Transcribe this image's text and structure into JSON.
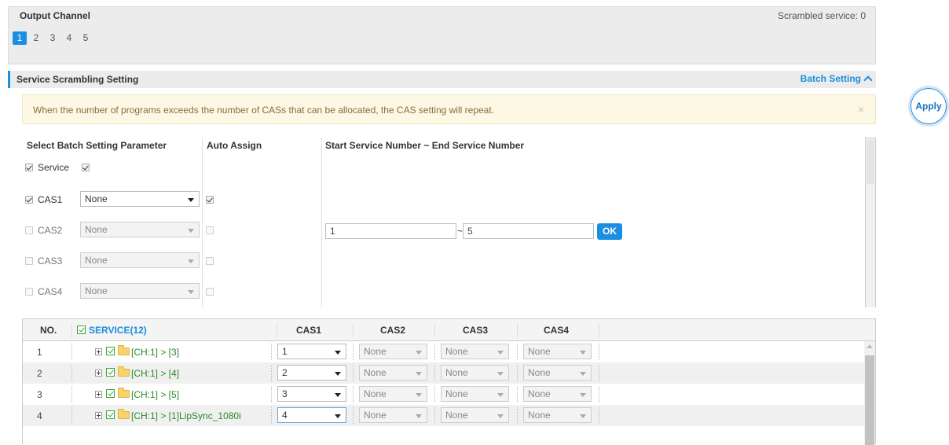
{
  "output_channel": {
    "title": "Output Channel",
    "scrambled_service": "Scrambled service: 0",
    "tabs": [
      "1",
      "2",
      "3",
      "4",
      "5"
    ],
    "active_tab": "1"
  },
  "section": {
    "title": "Service Scrambling Setting",
    "batch_setting": "Batch Setting"
  },
  "apply_label": "Apply",
  "alert": {
    "text": "When the number of programs exceeds the number of CASs that can be allocated, the CAS setting will repeat.",
    "close": "×"
  },
  "batch": {
    "col_param": "Select Batch Setting Parameter",
    "col_auto": "Auto Assign",
    "col_range": "Start Service Number ~ End Service Number",
    "service_label": "Service",
    "cas_rows": [
      {
        "label": "CAS1",
        "value": "None"
      },
      {
        "label": "CAS2",
        "value": "None"
      },
      {
        "label": "CAS3",
        "value": "None"
      },
      {
        "label": "CAS4",
        "value": "None"
      }
    ],
    "start_value": "1",
    "tilde": "~",
    "end_value": "5",
    "ok_label": "OK"
  },
  "table": {
    "headers": {
      "no": "NO.",
      "service": "SERVICE(12)",
      "cas1": "CAS1",
      "cas2": "CAS2",
      "cas3": "CAS3",
      "cas4": "CAS4"
    },
    "rows": [
      {
        "no": "1",
        "service": "[CH:1] > [3]",
        "cas1": "1",
        "cas2": "None",
        "cas3": "None",
        "cas4": "None"
      },
      {
        "no": "2",
        "service": "[CH:1] > [4]",
        "cas1": "2",
        "cas2": "None",
        "cas3": "None",
        "cas4": "None"
      },
      {
        "no": "3",
        "service": "[CH:1] > [5]",
        "cas1": "3",
        "cas2": "None",
        "cas3": "None",
        "cas4": "None"
      },
      {
        "no": "4",
        "service": "[CH:1] > [1]LipSync_1080i",
        "cas1": "4",
        "cas2": "None",
        "cas3": "None",
        "cas4": "None"
      }
    ]
  },
  "colors": {
    "accent": "#1a8ee0",
    "service_text": "#2a8a2a",
    "alert_bg": "#fcf8e3"
  }
}
